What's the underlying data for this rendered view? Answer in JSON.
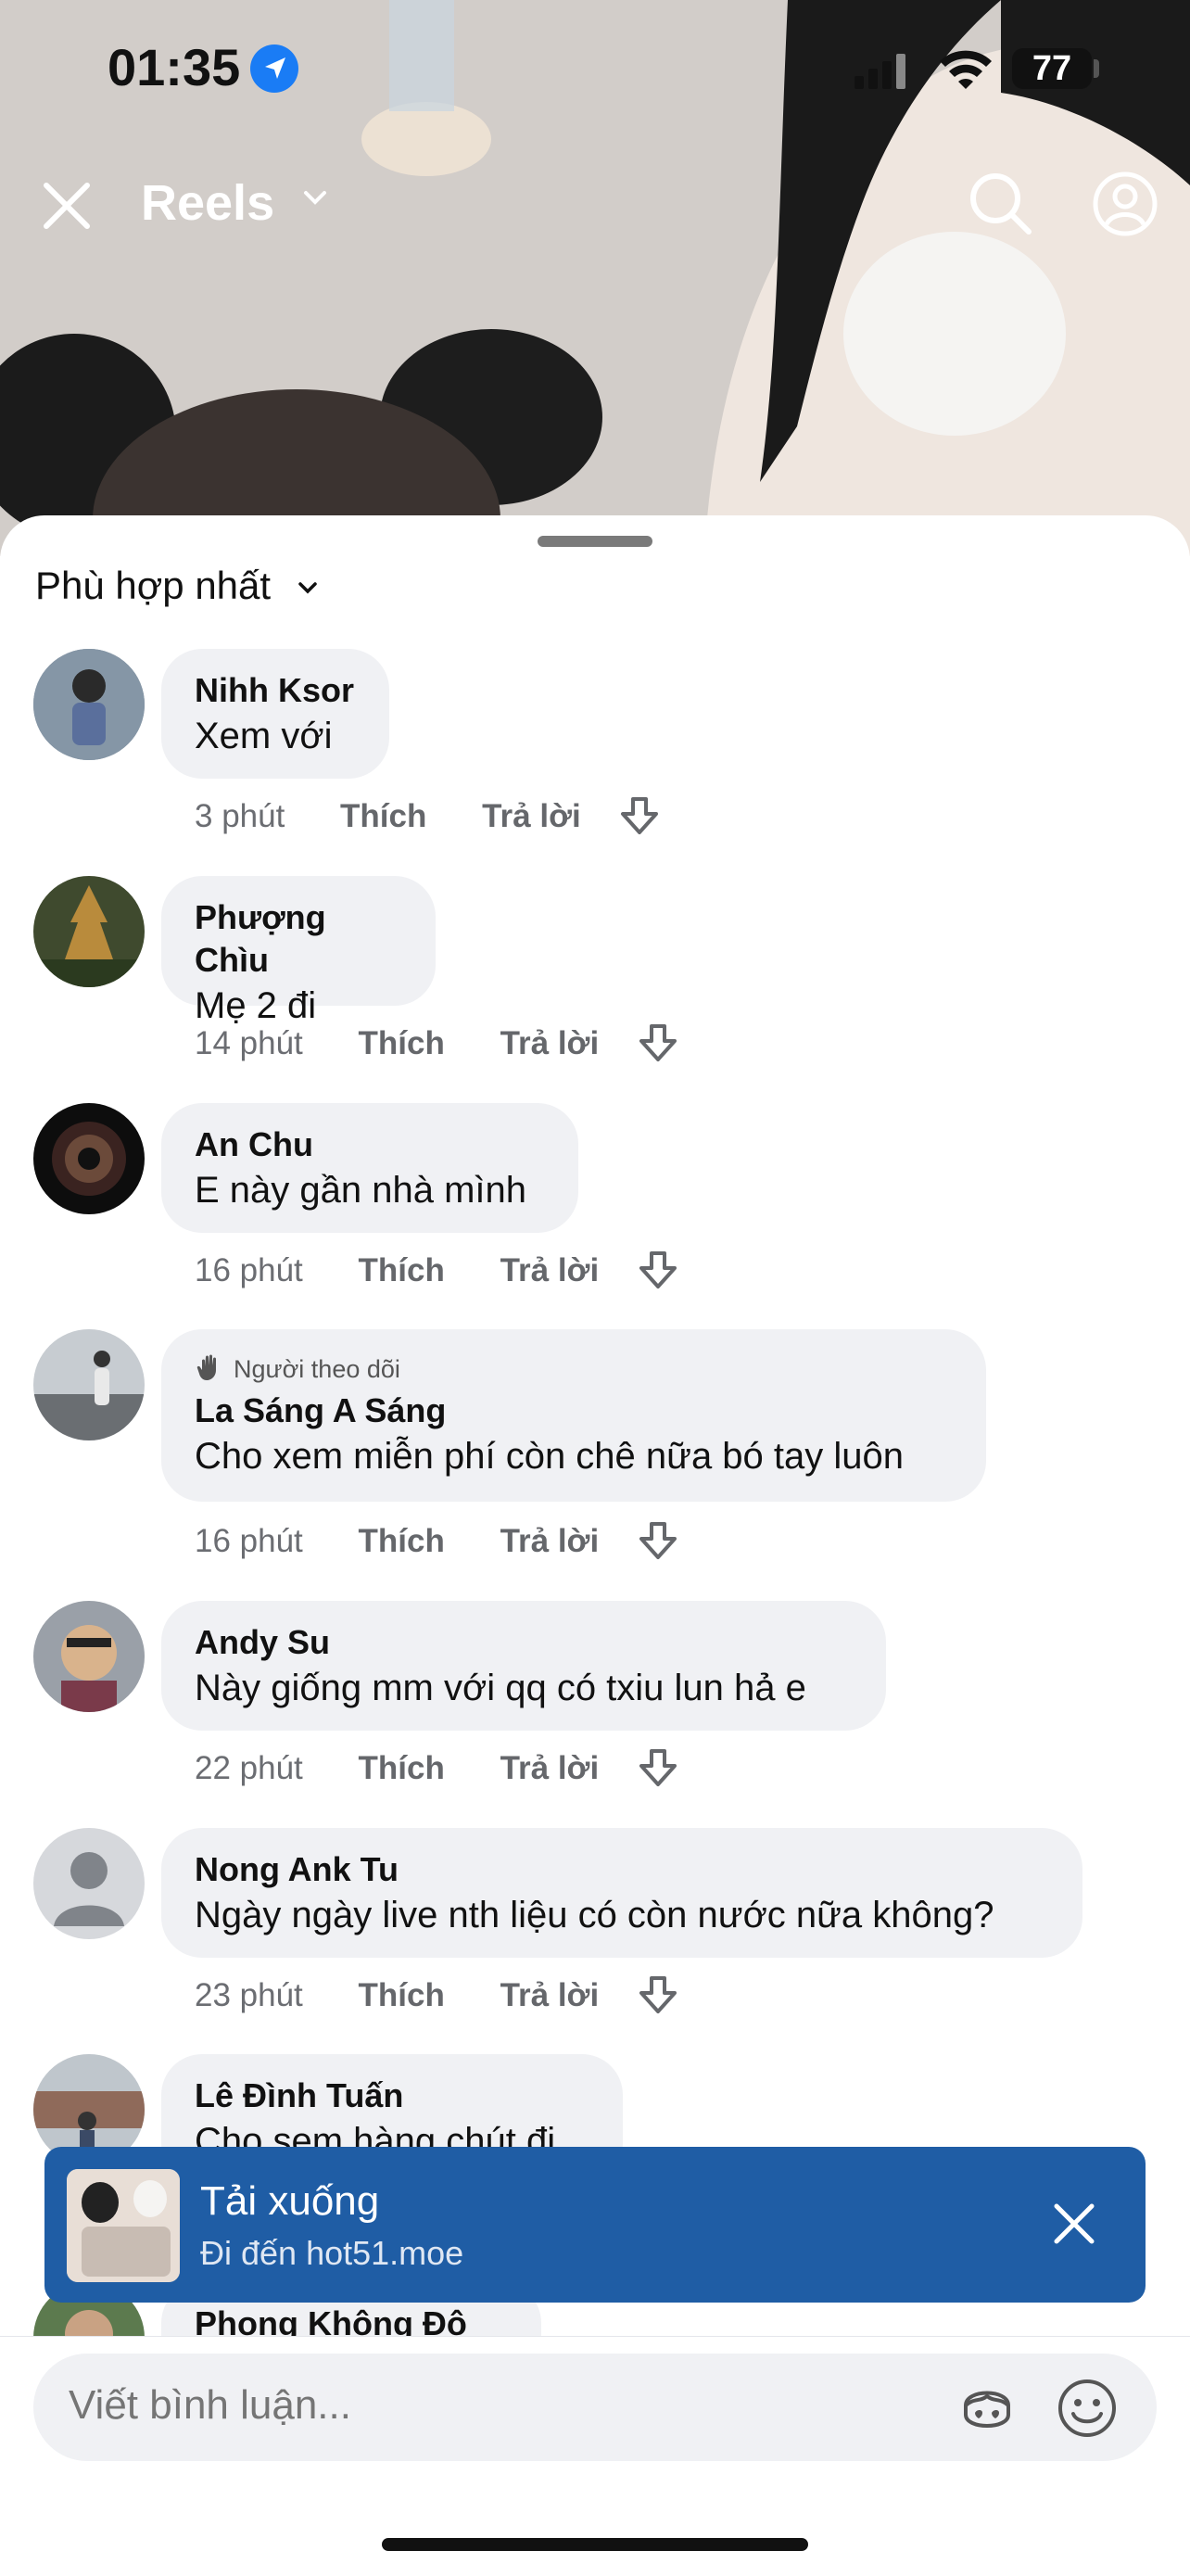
{
  "status": {
    "time": "01:35",
    "battery": "77"
  },
  "nav": {
    "title": "Reels"
  },
  "sort": {
    "label": "Phù hợp nhất"
  },
  "comments": [
    {
      "name": "Nihh Ksor",
      "text": "Xem với",
      "time": "3 phút",
      "like": "Thích",
      "reply": "Trả lời"
    },
    {
      "name": "Phượng Chìu",
      "text": "Mẹ 2 đi",
      "time": "14 phút",
      "like": "Thích",
      "reply": "Trả lời"
    },
    {
      "name": "An Chu",
      "text": "E này gần nhà mình",
      "time": "16 phút",
      "like": "Thích",
      "reply": "Trả lời"
    },
    {
      "badge": "Người theo dõi",
      "name": "La Sáng A Sáng",
      "text": "Cho xem miễn phí còn chê nữa bó tay luôn",
      "time": "16 phút",
      "like": "Thích",
      "reply": "Trả lời"
    },
    {
      "name": "Andy Su",
      "text": "Này giống mm với qq có txiu lun hả e",
      "time": "22 phút",
      "like": "Thích",
      "reply": "Trả lời"
    },
    {
      "name": "Nong Ank Tu",
      "text": "Ngày ngày live nth liệu có còn nước nữa không?",
      "time": "23 phút",
      "like": "Thích",
      "reply": "Trả lời"
    },
    {
      "name": "Lê Đình Tuấn",
      "text": "Cho sem hàng chút đi"
    },
    {
      "name": "Phong Không Đô"
    }
  ],
  "toast": {
    "title": "Tải xuống",
    "subtitle": "Đi đến hot51.moe"
  },
  "composer": {
    "placeholder": "Viết bình luận..."
  },
  "colors": {
    "toast_bg": "#1f5da5",
    "bubble_bg": "#f0f1f4",
    "location_blue": "#1a7cf5"
  }
}
